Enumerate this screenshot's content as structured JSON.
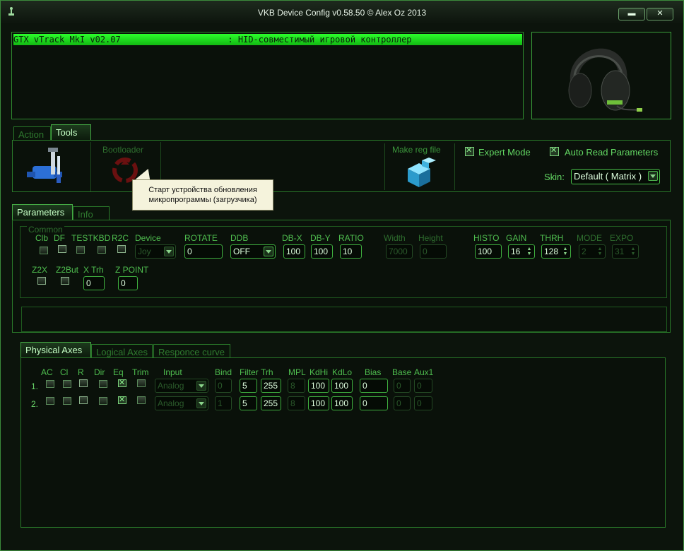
{
  "window": {
    "title": "VKB Device Config v0.58.50 © Alex Oz 2013"
  },
  "device_row": "GTX vTrack MkI v02.07                     : HID-совместимый игровой контроллер",
  "main_tabs": [
    "Action",
    "Tools"
  ],
  "tools": {
    "bootloader_label": "Bootloader",
    "make_reg_label": "Make reg file",
    "expert_mode_label": "Expert Mode",
    "auto_read_label": "Auto Read Parameters",
    "skin_label": "Skin:",
    "skin_value": "Default ( Matrix )",
    "tooltip_line1": "Старт устройства обновления",
    "tooltip_line2": "микропрограммы (загрузчика)"
  },
  "param_tabs": [
    "Parameters",
    "Info"
  ],
  "common": {
    "group_label": "Common",
    "labels": [
      "Clb",
      "DF",
      "TESTKBD",
      "R2C",
      "Device",
      "ROTATE",
      "DDB",
      "DB-X",
      "DB-Y",
      "RATIO",
      "Width",
      "Height",
      "HISTO",
      "GAIN",
      "THRH",
      "MODE",
      "EXPO"
    ],
    "device_value": "Joy",
    "rotate_value": "0",
    "ddb_value": "OFF",
    "dbx_value": "100",
    "dby_value": "100",
    "ratio_value": "10",
    "width_value": "7000",
    "height_value": "0",
    "histo_value": "100",
    "gain_value": "16",
    "thrh_value": "128",
    "mode_value": "2",
    "expo_value": "31",
    "row2_labels": [
      "Z2X",
      "Z2But",
      "X Trh",
      "Z POINT"
    ],
    "xtrh_value": "0",
    "zpoint_value": "0"
  },
  "axes_tabs": [
    "Physical Axes",
    "Logical Axes",
    "Responce curve"
  ],
  "axes": {
    "headers": [
      "AC",
      "Cl",
      "R",
      "Dir",
      "Eq",
      "Trim",
      "Input",
      "Bind",
      "Filter",
      "Trh",
      "MPL",
      "KdHi",
      "KdLo",
      "Bias",
      "Base",
      "Aux1"
    ],
    "rows": [
      {
        "num": "1.",
        "input": "Analog",
        "bind": "0",
        "filter": "5",
        "trh": "255",
        "mpl": "8",
        "kdhi": "100",
        "kdlo": "100",
        "bias": "0",
        "base": "0",
        "aux1": "0"
      },
      {
        "num": "2.",
        "input": "Analog",
        "bind": "1",
        "filter": "5",
        "trh": "255",
        "mpl": "8",
        "kdhi": "100",
        "kdlo": "100",
        "bias": "0",
        "base": "0",
        "aux1": "0"
      }
    ]
  },
  "colors": {
    "accent": "#3fd43f",
    "background": "#0a110a",
    "border": "#2a7a2a"
  }
}
